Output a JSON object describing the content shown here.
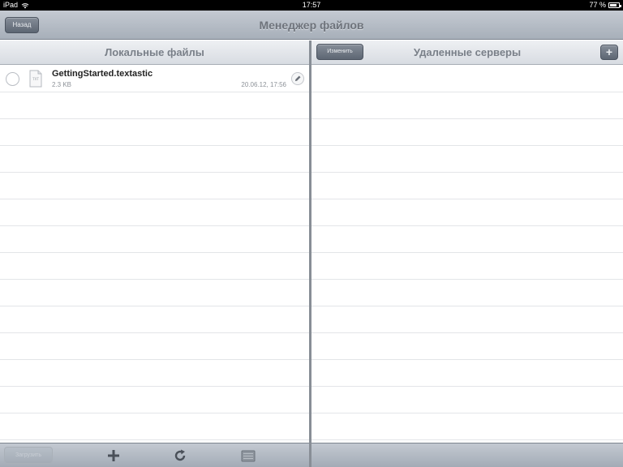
{
  "status_bar": {
    "device": "iPad",
    "time": "17:57",
    "battery": "77 %",
    "battery_level": 0.77
  },
  "nav_bar": {
    "title": "Менеджер файлов",
    "back_label": "Назад"
  },
  "local_pane": {
    "title": "Локальные файлы",
    "files": [
      {
        "name": "GettingStarted.textastic",
        "size": "2.3 KB",
        "date": "20.06.12, 17:56"
      }
    ],
    "toolbar": {
      "upload_label": "Загрузить"
    }
  },
  "remote_pane": {
    "title": "Удаленные серверы",
    "edit_label": "Изменить",
    "add_label": "+"
  }
}
